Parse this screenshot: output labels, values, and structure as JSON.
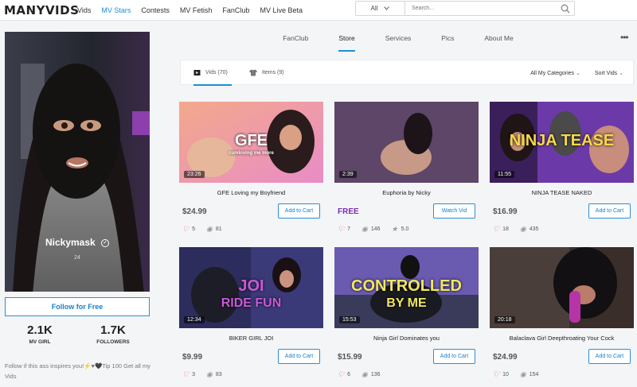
{
  "header": {
    "logo": "MANYVIDS",
    "nav": [
      {
        "label": "Vids",
        "active": false
      },
      {
        "label": "MV Stars",
        "active": true
      },
      {
        "label": "Contests",
        "active": false
      },
      {
        "label": "MV Fetish",
        "active": false
      },
      {
        "label": "FanClub",
        "active": false
      },
      {
        "label": "MV Live Beta",
        "active": false
      }
    ],
    "search": {
      "scope": "All",
      "placeholder": "Search..."
    }
  },
  "profile": {
    "name": "Nickymask",
    "age": "24",
    "follow_label": "Follow for Free",
    "stats": [
      {
        "value": "2.1K",
        "label": "MV GIRL"
      },
      {
        "value": "1.7K",
        "label": "FOLLOWERS"
      }
    ],
    "bio": "Follow if this ass inspires you!⚡♥🖤Tip 100 Get all my Vids"
  },
  "tabs": [
    "FanClub",
    "Store",
    "Services",
    "Pics",
    "About Me"
  ],
  "active_tab": "Store",
  "filter": {
    "vids_label": "Vids (70)",
    "items_label": "Items (9)",
    "categories_label": "All My Categories",
    "sort_label": "Sort Vids"
  },
  "videos": [
    {
      "title": "GFE Loving my Boyfriend",
      "duration": "23:26",
      "price": "$24.99",
      "free": false,
      "button": "Add to Cart",
      "likes": "5",
      "views": "81",
      "rating": "",
      "overlay": "GFE",
      "overlay_sub": "cumloving me more"
    },
    {
      "title": "Euphoria by Nicky",
      "duration": "2:39",
      "price": "FREE",
      "free": true,
      "button": "Watch Vid",
      "likes": "7",
      "views": "146",
      "rating": "5.0",
      "overlay": "",
      "overlay_sub": ""
    },
    {
      "title": "NINJA TEASE NAKED",
      "duration": "11:55",
      "price": "$16.99",
      "free": false,
      "button": "Add to Cart",
      "likes": "18",
      "views": "435",
      "rating": "",
      "overlay": "NINJA TEASE",
      "overlay_sub": ""
    },
    {
      "title": "BIKER GIRL JOI",
      "duration": "12:34",
      "price": "$9.99",
      "free": false,
      "button": "Add to Cart",
      "likes": "3",
      "views": "83",
      "rating": "",
      "overlay": "JOI",
      "overlay_sub": "RIDE FUN"
    },
    {
      "title": "Ninja Girl Dominates you",
      "duration": "15:53",
      "price": "$15.99",
      "free": false,
      "button": "Add to Cart",
      "likes": "6",
      "views": "136",
      "rating": "",
      "overlay": "CONTROLLED",
      "overlay_sub": "BY ME"
    },
    {
      "title": "Balaclava Girl Deepthroating Your Cock",
      "duration": "20:18",
      "price": "$24.99",
      "free": false,
      "button": "Add to Cart",
      "likes": "10",
      "views": "154",
      "rating": "",
      "overlay": "",
      "overlay_sub": ""
    }
  ],
  "colors": {
    "accent": "#1a8fd6",
    "free": "#7b2fb5",
    "heart": "#e8456f"
  }
}
